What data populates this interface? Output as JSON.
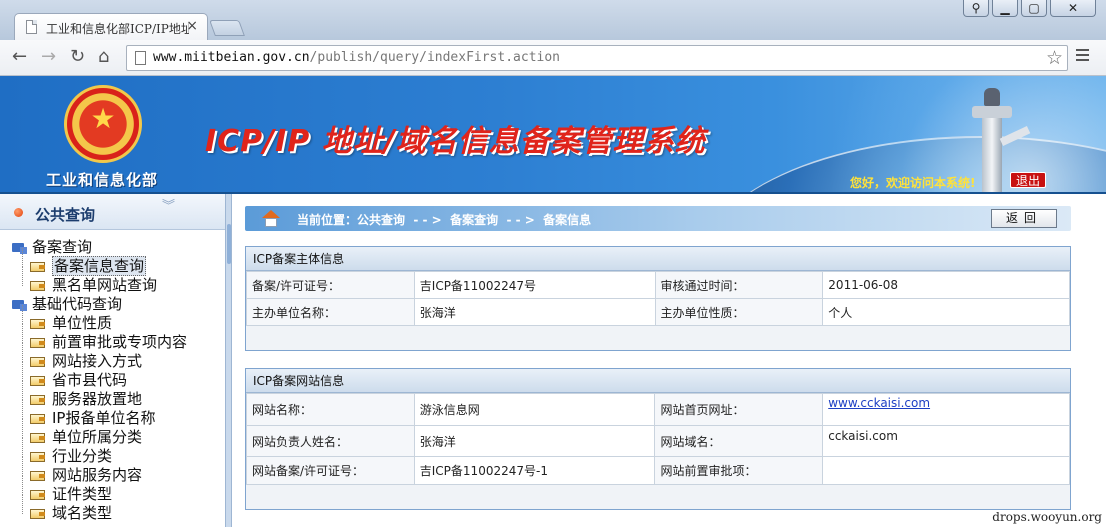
{
  "browser": {
    "tab_title": "工业和信息化部ICP/IP地址",
    "tab_close": "×",
    "url_host": "www.miitbeian.gov.cn",
    "url_path": "/publish/query/indexFirst.action",
    "nav": {
      "back": "←",
      "forward": "→",
      "reload": "↻",
      "home": "⌂"
    },
    "bookmark_star": "☆",
    "window_controls": [
      "⚲",
      "▁",
      "▢",
      "✕"
    ]
  },
  "banner": {
    "ministry": "工业和信息化部",
    "system_title": "ICP/IP 地址/域名信息备案管理系统",
    "welcome": "您好，欢迎访问本系统!",
    "logout": "退出"
  },
  "sidebar": {
    "title": "公共查询",
    "collapse": "︾",
    "items": [
      {
        "label": "备案查询",
        "type": "group"
      },
      {
        "label": "备案信息查询",
        "type": "leaf",
        "selected": true
      },
      {
        "label": "黑名单网站查询",
        "type": "leaf"
      },
      {
        "label": "基础代码查询",
        "type": "group"
      },
      {
        "label": "单位性质",
        "type": "leaf"
      },
      {
        "label": "前置审批或专项内容",
        "type": "leaf"
      },
      {
        "label": "网站接入方式",
        "type": "leaf"
      },
      {
        "label": "省市县代码",
        "type": "leaf"
      },
      {
        "label": "服务器放置地",
        "type": "leaf"
      },
      {
        "label": "IP报备单位名称",
        "type": "leaf"
      },
      {
        "label": "单位所属分类",
        "type": "leaf"
      },
      {
        "label": "行业分类",
        "type": "leaf"
      },
      {
        "label": "网站服务内容",
        "type": "leaf"
      },
      {
        "label": "证件类型",
        "type": "leaf"
      },
      {
        "label": "域名类型",
        "type": "leaf"
      }
    ]
  },
  "breadcrumb": {
    "text": "当前位置：公共查询  - - >  备案查询  - - >  备案信息",
    "back_button": "返回"
  },
  "subject_panel": {
    "title": "ICP备案主体信息",
    "rows": [
      [
        "备案/许可证号：",
        "吉ICP备11002247号",
        "审核通过时间：",
        "2011-06-08"
      ],
      [
        "主办单位名称：",
        "张海洋",
        "主办单位性质：",
        "个人"
      ]
    ]
  },
  "website_panel": {
    "title": "ICP备案网站信息",
    "rows": [
      [
        "网站名称：",
        "游泳信息网",
        "网站首页网址：",
        "www.cckaisi.com"
      ],
      [
        "网站负责人姓名：",
        "张海洋",
        "网站域名：",
        "cckaisi.com"
      ],
      [
        "网站备案/许可证号：",
        "吉ICP备11002247号-1",
        "网站前置审批项：",
        ""
      ]
    ]
  },
  "watermark": "drops.wooyun.org"
}
